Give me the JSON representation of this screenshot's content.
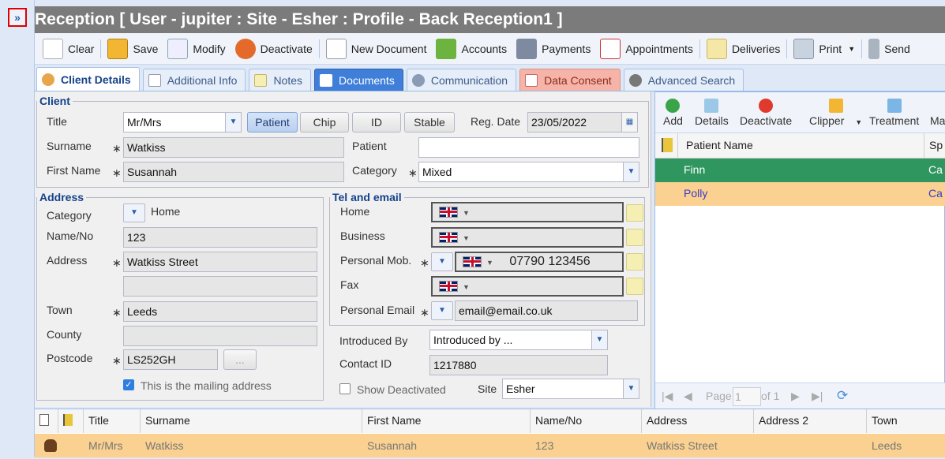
{
  "window": {
    "title": "Reception [ User - jupiter : Site - Esher : Profile - Back Reception1 ]"
  },
  "toolbar": {
    "items": [
      {
        "label": "Clear",
        "icon": "clear-icon"
      },
      {
        "label": "Save",
        "icon": "save-icon"
      },
      {
        "label": "Modify",
        "icon": "modify-icon"
      },
      {
        "label": "Deactivate",
        "icon": "deactivate-user-icon"
      },
      {
        "label": "New Document",
        "icon": "new-document-icon"
      },
      {
        "label": "Accounts",
        "icon": "accounts-icon"
      },
      {
        "label": "Payments",
        "icon": "payments-icon"
      },
      {
        "label": "Appointments",
        "icon": "calendar-icon"
      },
      {
        "label": "Deliveries",
        "icon": "deliveries-icon"
      },
      {
        "label": "Print",
        "icon": "printer-icon"
      },
      {
        "label": "Send",
        "icon": "phone-icon"
      }
    ]
  },
  "tabs": [
    {
      "label": "Client Details",
      "state": "active"
    },
    {
      "label": "Additional Info",
      "state": ""
    },
    {
      "label": "Notes",
      "state": ""
    },
    {
      "label": "Documents",
      "state": "documents"
    },
    {
      "label": "Communication",
      "state": ""
    },
    {
      "label": "Data Consent",
      "state": "consent"
    },
    {
      "label": "Advanced Search",
      "state": ""
    }
  ],
  "client": {
    "legend": "Client",
    "title_label": "Title",
    "title_value": "Mr/Mrs",
    "type_buttons": [
      "Patient",
      "Chip",
      "ID",
      "Stable"
    ],
    "reg_date_label": "Reg. Date",
    "reg_date": "23/05/2022",
    "surname_label": "Surname",
    "surname": "Watkiss",
    "patient_label": "Patient",
    "patient_value": "",
    "first_name_label": "First Name",
    "first_name": "Susannah",
    "category_label": "Category",
    "category_value": "Mixed"
  },
  "address": {
    "legend": "Address",
    "category_label": "Category",
    "category_value": "Home",
    "name_no_label": "Name/No",
    "name_no": "123",
    "address_label": "Address",
    "address_line1": "Watkiss Street",
    "address_line2": "",
    "town_label": "Town",
    "town": "Leeds",
    "county_label": "County",
    "county": "",
    "postcode_label": "Postcode",
    "postcode": "LS252GH",
    "lookup_button": "...",
    "mailing_label": "This is the mailing address"
  },
  "tel": {
    "legend": "Tel and email",
    "home_label": "Home",
    "business_label": "Business",
    "mobile_label": "Personal Mob.",
    "mobile_value": "07790 123456",
    "fax_label": "Fax",
    "email_label": "Personal Email",
    "email_value": "email@email.co.uk"
  },
  "extra": {
    "introduced_label": "Introduced By",
    "introduced_value": "Introduced by ...",
    "contact_id_label": "Contact ID",
    "contact_id": "1217880",
    "show_deactivated_label": "Show Deactivated",
    "site_label": "Site",
    "site_value": "Esher"
  },
  "patients": {
    "toolbar": [
      "Add",
      "Details",
      "Deactivate",
      "Clipper",
      "Treatment",
      "Ma"
    ],
    "header_name": "Patient Name",
    "header_species": "Sp",
    "rows": [
      {
        "name": "Finn",
        "species": "Ca"
      },
      {
        "name": "Polly",
        "species": "Ca"
      }
    ],
    "paging_page": "Page",
    "paging_value": "1",
    "paging_of": "of 1"
  },
  "clients_grid": {
    "headers": [
      "Title",
      "Surname",
      "First Name",
      "Name/No",
      "Address",
      "Address 2",
      "Town"
    ],
    "row": [
      "Mr/Mrs",
      "Watkiss",
      "Susannah",
      "123",
      "Watkiss Street",
      "",
      "Leeds"
    ]
  },
  "colors": {
    "title_bar": "#7b7b7b",
    "selected_row": "#fad190",
    "finn_row": "#2f9660",
    "polly_row": "#fad190",
    "documents_tab": "#3f7fd9",
    "consent_tab": "#f6b4a8"
  }
}
